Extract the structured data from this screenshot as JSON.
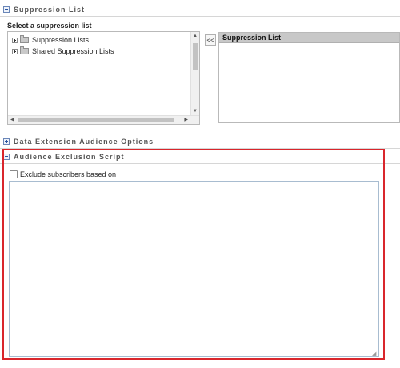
{
  "sections": {
    "suppression": {
      "title": "Suppression List",
      "expanded": true
    },
    "data_extension": {
      "title": "Data Extension Audience Options",
      "expanded": false
    },
    "exclusion": {
      "title": "Audience Exclusion Script",
      "expanded": true
    }
  },
  "suppression_select": {
    "label": "Select a suppression list",
    "tree": [
      {
        "label": "Suppression Lists",
        "icon": "folder-icon"
      },
      {
        "label": "Shared Suppression Lists",
        "icon": "folder-icon"
      }
    ],
    "move_button": "<<",
    "selected_header": "Suppression List"
  },
  "exclusion": {
    "checkbox_label": "Exclude subscribers based on",
    "checked": false,
    "script_value": ""
  },
  "colors": {
    "highlight_border": "#d9262c",
    "section_title": "#555555",
    "list_header_bg": "#c8c8c8"
  }
}
